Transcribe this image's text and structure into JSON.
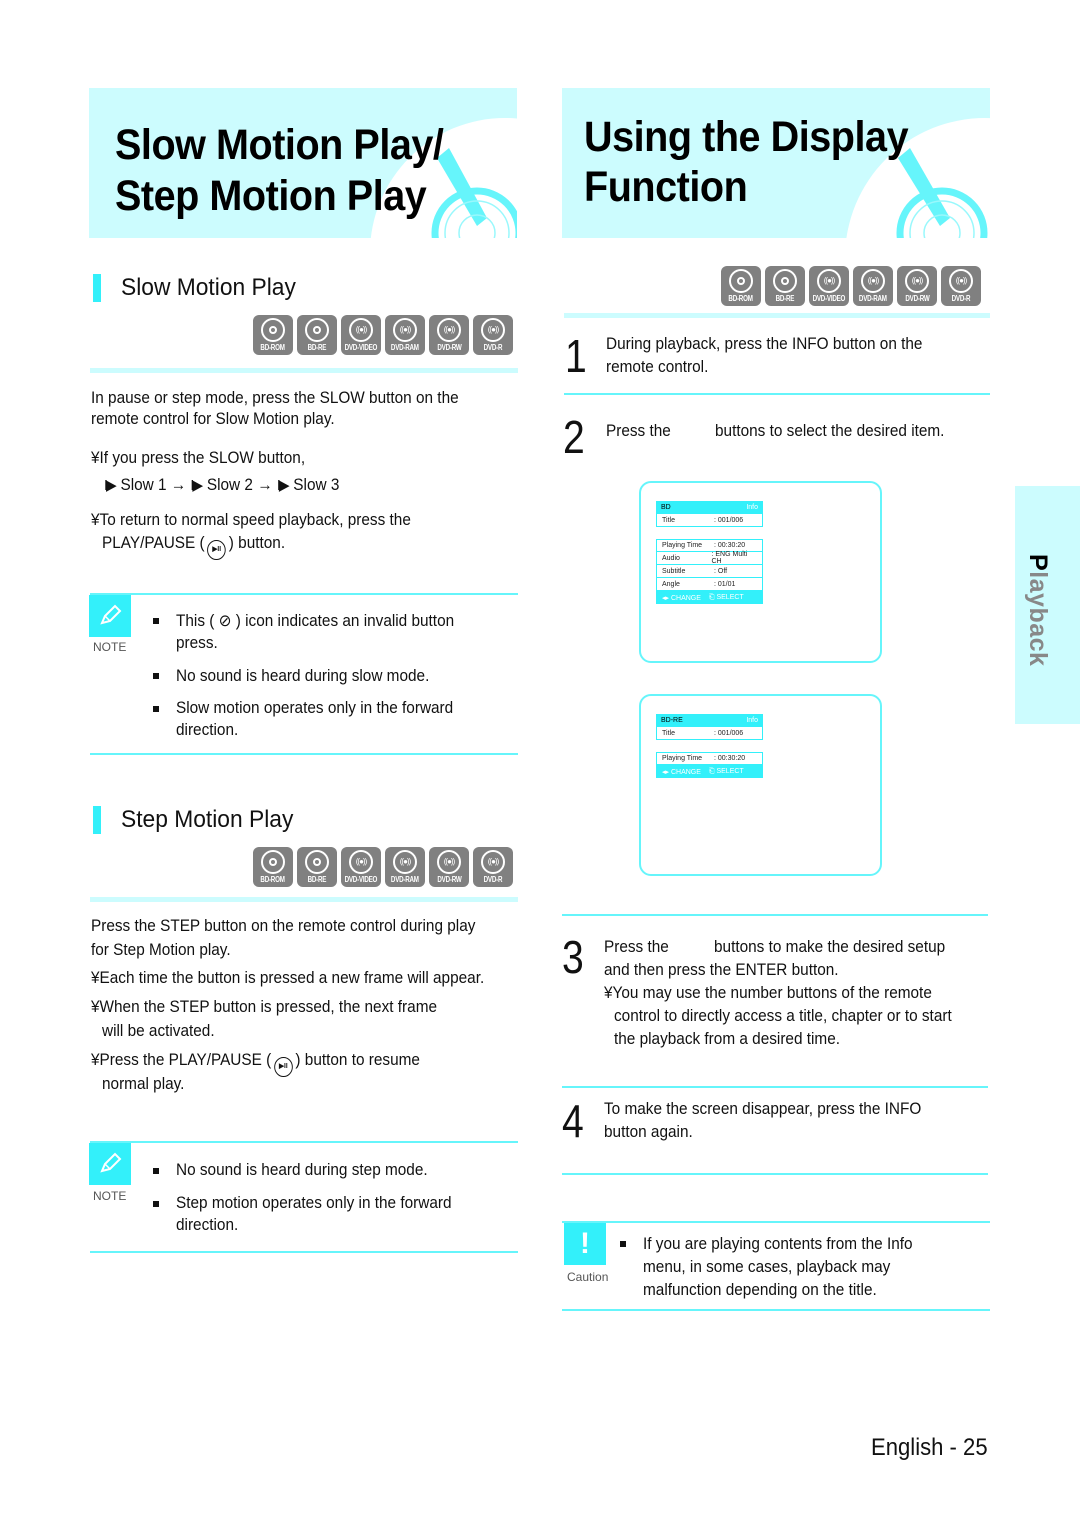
{
  "left": {
    "banner_title_line1": "Slow  Motion Play/",
    "banner_title_line2": "Step Motion Play",
    "slow": {
      "heading": "Slow Motion Play",
      "intro_line1": "In pause or step mode, press the SLOW button on the",
      "intro_line2": "remote control for Slow Motion play.",
      "bullet1": "¥If you press the SLOW button,",
      "sequence": [
        "Slow 1",
        "Slow 2",
        "Slow 3"
      ],
      "arrow": "→",
      "bullet2_line1": "¥To return to normal speed playback, press the",
      "bullet2_pre": "PLAY/PAUSE  (",
      "bullet2_post": ") button.",
      "note_label": "NOTE",
      "notes": [
        {
          "pre": "This (",
          "icon": "⊘",
          "post": ") icon indicates an invalid button",
          "cont": "press."
        },
        {
          "text": "No sound is heard during slow mode."
        },
        {
          "text": "Slow motion operates only in the forward",
          "cont": "direction."
        }
      ]
    },
    "step": {
      "heading": "Step Motion Play",
      "intro_line1": "Press the STEP button on the remote control during play",
      "intro_line2": "for Step Motion play.",
      "bullet1": "¥Each time the button is pressed a new frame will appear.",
      "bullet2_line1": "¥When the STEP button is pressed, the next frame",
      "bullet2_line2": "will be activated.",
      "bullet3_pre": "¥Press the PLAY/PAUSE  (",
      "bullet3_post": ") button to resume",
      "bullet3_line2": "normal play.",
      "note_label": "NOTE",
      "notes": [
        {
          "text": "No sound is heard during step mode."
        },
        {
          "text": "Step motion operates only in the forward",
          "cont": "direction."
        }
      ]
    }
  },
  "discs": [
    "BD-ROM",
    "BD-RE",
    "DVD-VIDEO",
    "DVD-RAM",
    "DVD-RW",
    "DVD-R"
  ],
  "play_pause_glyph": "▶II",
  "right": {
    "banner_title_line1": "Using the Display",
    "banner_title_line2": "Function",
    "steps": [
      {
        "num": "1",
        "line1": "During playback, press the INFO button on the",
        "line2": "remote control."
      },
      {
        "num": "2",
        "pre": "Press the",
        "post": "buttons to select the desired item."
      },
      {
        "num": "3",
        "pre": "Press the",
        "post": "buttons to make the desired setup",
        "line2": "and then press the ENTER button.",
        "sub1": "¥You may use the number buttons of the remote",
        "sub2": "control to directly access a title, chapter or to start",
        "sub3": "the playback from a desired time."
      },
      {
        "num": "4",
        "line1": "To make the screen disappear, press the INFO",
        "line2": "button again."
      }
    ],
    "osd_bd": {
      "header": "BD",
      "info": "Info",
      "title_key": "Title",
      "title_val": ": 001/006",
      "rows": [
        {
          "k": "Playing Time",
          "v": ": 00:30:20"
        },
        {
          "k": "Audio",
          "v": ":  ENG Multi CH"
        },
        {
          "k": "Subtitle",
          "v": ": Off"
        },
        {
          "k": "Angle",
          "v": ": 01/01"
        }
      ],
      "footer_change": "◂▸ CHANGE",
      "footer_select": "⎗ SELECT"
    },
    "osd_bdre": {
      "header": "BD-RE",
      "info": "Info",
      "title_key": "Title",
      "title_val": ": 001/006",
      "rows": [
        {
          "k": "Playing Time",
          "v": ": 00:30:20"
        }
      ],
      "footer_change": "◂▸ CHANGE",
      "footer_select": "⎗ SELECT"
    },
    "caution_label": "Caution",
    "caution_lines": [
      "If you are playing contents from the Info",
      "menu, in some cases, playback may",
      "malfunction depending on the title."
    ]
  },
  "side_tab": {
    "first": "P",
    "rest": "layback"
  },
  "footer": "English - 25",
  "colors": {
    "accent": "#33f0fa",
    "light": "#ccfcfe",
    "disc": "#808080"
  }
}
